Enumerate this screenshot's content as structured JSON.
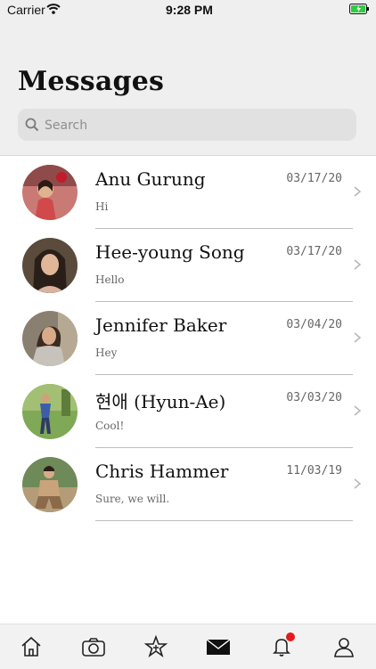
{
  "status_bar": {
    "carrier": "Carrier",
    "time": "9:28 PM"
  },
  "header": {
    "title": "Messages"
  },
  "search": {
    "placeholder": "Search"
  },
  "conversations": [
    {
      "name": "Anu Gurung",
      "date": "03/17/20",
      "preview": "Hi"
    },
    {
      "name": "Hee-young Song",
      "date": "03/17/20",
      "preview": "Hello"
    },
    {
      "name": "Jennifer Baker",
      "date": "03/04/20",
      "preview": "Hey"
    },
    {
      "name": "현애 (Hyun-Ae)",
      "date": "03/03/20",
      "preview": "Cool!"
    },
    {
      "name": "Chris Hammer",
      "date": "11/03/19",
      "preview": "Sure, we will."
    }
  ],
  "tab_bar": {
    "items": [
      {
        "icon": "home-icon"
      },
      {
        "icon": "camera-icon"
      },
      {
        "icon": "star-icon"
      },
      {
        "icon": "mail-icon",
        "active": true
      },
      {
        "icon": "bell-icon",
        "badge": true
      },
      {
        "icon": "profile-icon"
      }
    ]
  },
  "colors": {
    "header_bg": "#efefef",
    "badge": "#e4191b",
    "battery": "#2ecc40"
  }
}
